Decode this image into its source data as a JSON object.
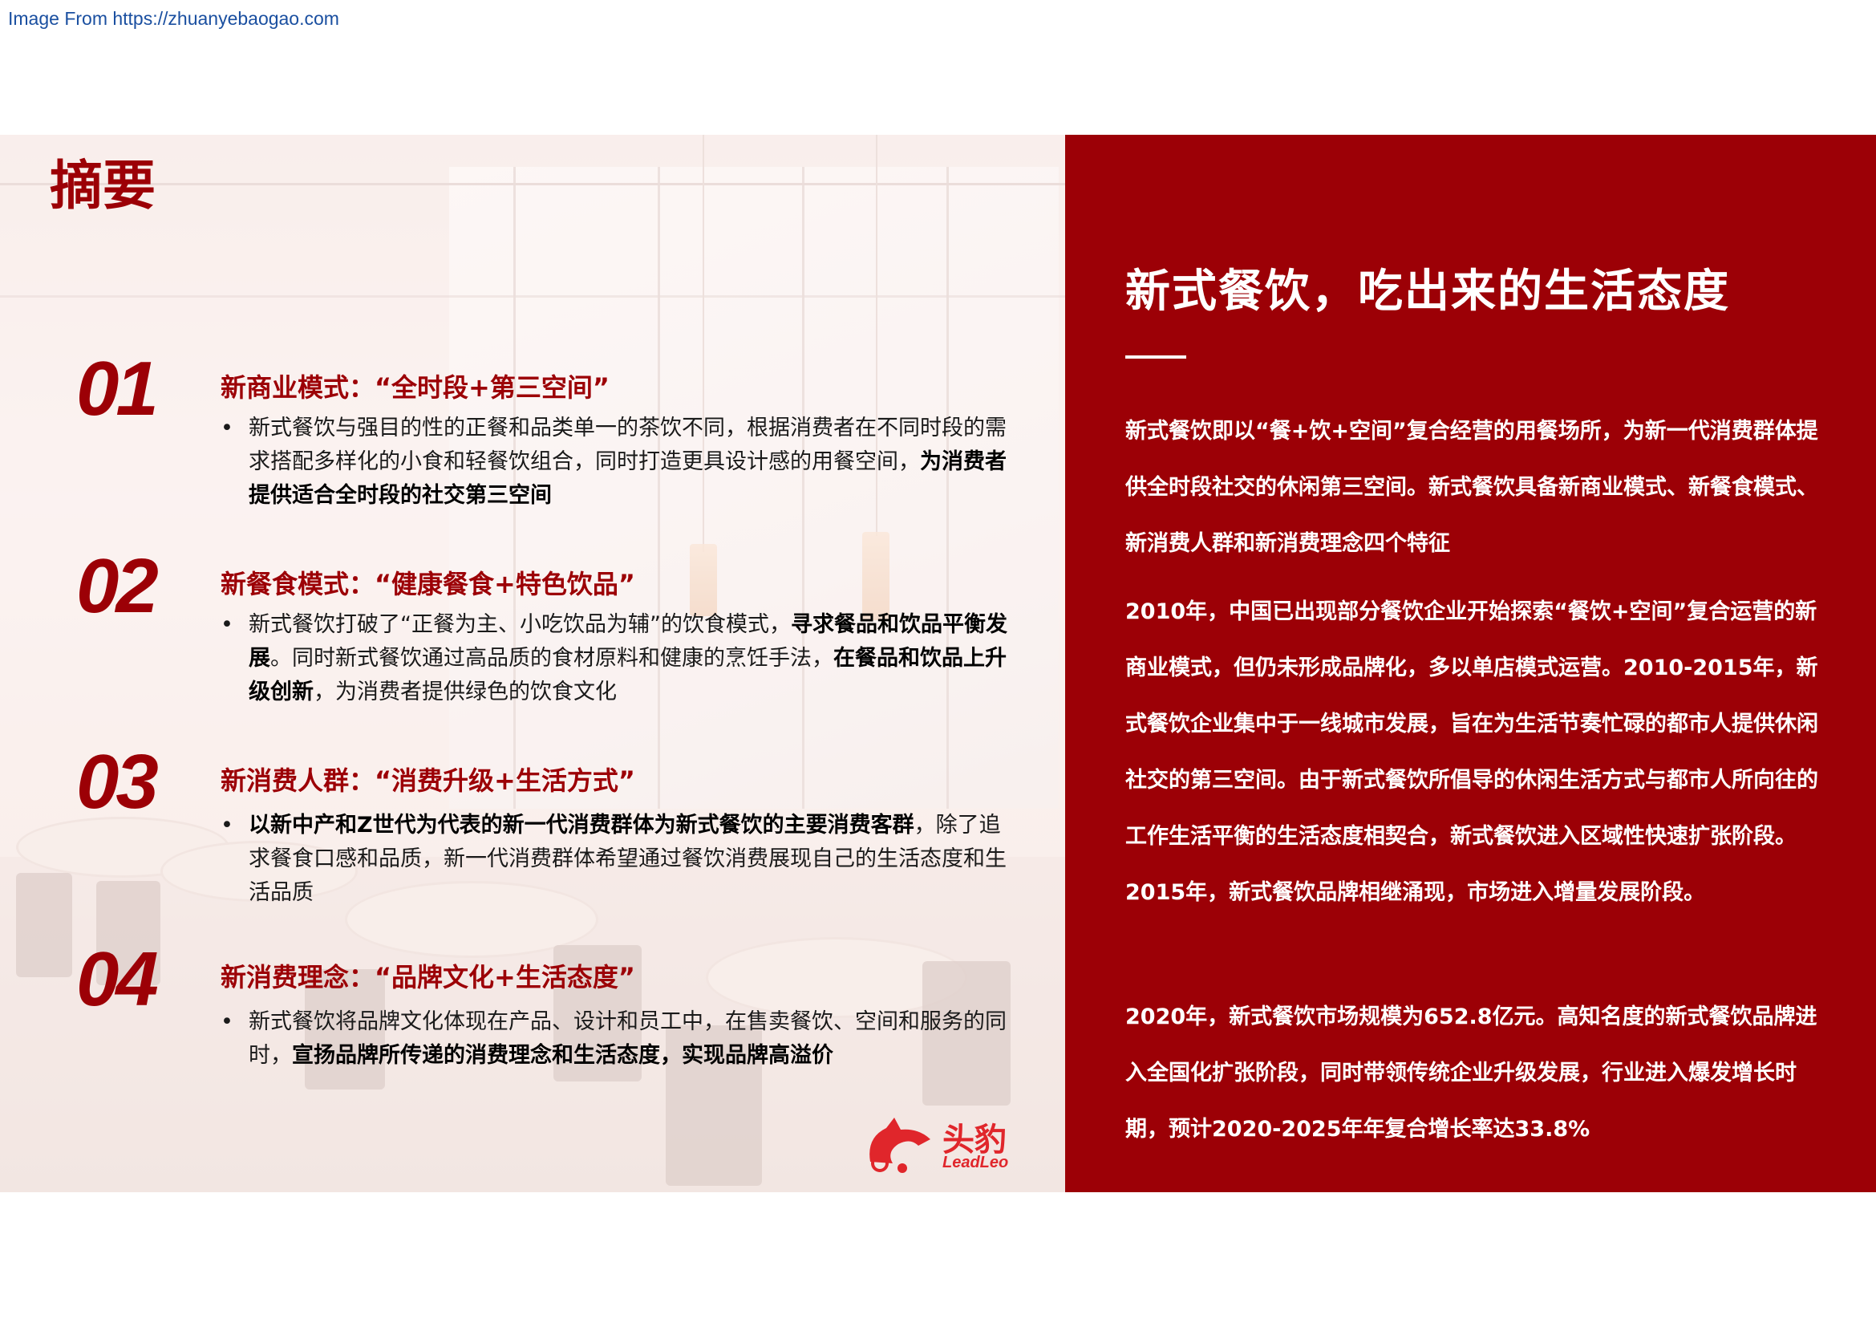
{
  "source_caption": "Image From https://zhuanyebaogao.com",
  "page_title": "摘要",
  "items": [
    {
      "number": "01",
      "title": "新商业模式：“全时段+第三空间”",
      "text_normal": "新式餐饮与强目的性的正餐和品类单一的茶饮不同，根据消费者在不同时段的需求搭配多样化的小食和轻餐饮组合，同时打造更具设计感的用餐空间，",
      "text_bold": "为消费者提供适合全时段的社交第三空间"
    },
    {
      "number": "02",
      "title": "新餐食模式：“健康餐食+特色饮品”",
      "text_1": "新式餐饮打破了“正餐为主、小吃饮品为辅”的饮食模式，",
      "bold_1": "寻求餐品和饮品平衡发展",
      "text_2": "。同时新式餐饮通过高品质的食材原料和健康的烹饪手法，",
      "bold_2": "在餐品和饮品上升级创新",
      "text_3": "，为消费者提供绿色的饮食文化"
    },
    {
      "number": "03",
      "title": "新消费人群：“消费升级+生活方式”",
      "bold_1": "以新中产和Z世代为代表的新一代消费群体为新式餐饮的主要消费客群",
      "text_1": "，除了追求餐食口感和品质，新一代消费群体希望通过餐饮消费展现自己的生活态度和生活品质"
    },
    {
      "number": "04",
      "title": "新消费理念：“品牌文化+生活态度”",
      "text_1": "新式餐饮将品牌文化体现在产品、设计和员工中，在售卖餐饮、空间和服务的同时，",
      "bold_1": "宣扬品牌所传递的消费理念和生活态度，实现品牌高溢价"
    }
  ],
  "right_panel": {
    "title": "新式餐饮，吃出来的生活态度",
    "paragraphs": [
      "新式餐饮即以“餐+饮+空间”复合经营的用餐场所，为新一代消费群体提供全时段社交的休闲第三空间。新式餐饮具备新商业模式、新餐食模式、新消费人群和新消费理念四个特征",
      "2010年，中国已出现部分餐饮企业开始探索“餐饮+空间”复合运营的新商业模式，但仍未形成品牌化，多以单店模式运营。2010-2015年，新式餐饮企业集中于一线城市发展，旨在为生活节奏忙碌的都市人提供休闲社交的第三空间。由于新式餐饮所倡导的休闲生活方式与都市人所向往的工作生活平衡的生活态度相契合，新式餐饮进入区域性快速扩张阶段。2015年，新式餐饮品牌相继涌现，市场进入增量发展阶段。",
      "2020年，新式餐饮市场规模为652.8亿元。高知名度的新式餐饮品牌进入全国化扩张阶段，同时带领传统企业升级发展，行业进入爆发增长时期，预计2020-2025年年复合增长率达33.8%"
    ],
    "background_color": "#9c0006"
  },
  "logo": {
    "cn": "头豹",
    "en": "LeadLeo",
    "color": "#e0262b"
  },
  "accent_color": "#9c0006"
}
